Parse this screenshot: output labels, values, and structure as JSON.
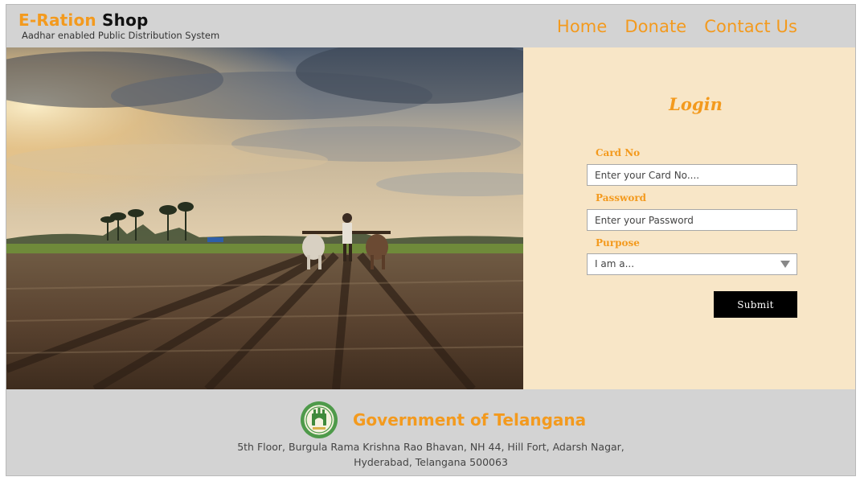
{
  "header": {
    "brand_part1": "E-Ration",
    "brand_part2": "Shop",
    "subtitle": "Aadhar enabled Public Distribution System",
    "nav": [
      "Home",
      "Donate",
      "Contact Us"
    ]
  },
  "login": {
    "title": "Login",
    "card_label": "Card No",
    "card_placeholder": "Enter your Card No....",
    "password_label": "Password",
    "password_placeholder": "Enter your Password",
    "purpose_label": "Purpose",
    "purpose_selected": "I am a...",
    "submit_label": "Submit"
  },
  "footer": {
    "government": "Government of Telangana",
    "address_line1": "5th Floor, Burgula Rama Krishna Rao Bhavan, NH 44, Hill Fort, Adarsh Nagar,",
    "address_line2": "Hyderabad, Telangana 500063"
  },
  "colors": {
    "accent": "#f39a1e",
    "header_bg": "#d3d3d3",
    "login_bg": "#f8e6c7",
    "button_bg": "#000000"
  },
  "icons": {
    "seal": "telangana-emblem-icon",
    "dropdown": "triangle-down-icon"
  }
}
